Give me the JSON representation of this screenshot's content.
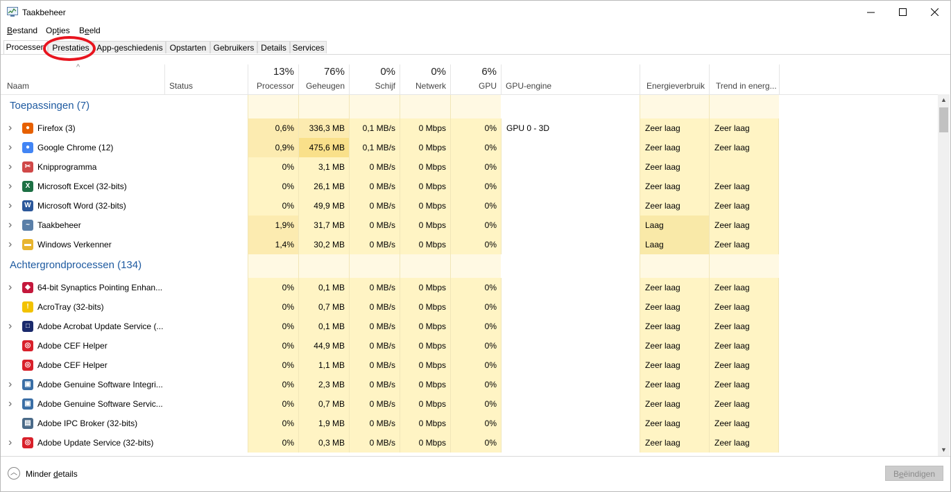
{
  "window": {
    "title": "Taakbeheer"
  },
  "menu": [
    {
      "pre": "",
      "ul": "B",
      "post": "estand"
    },
    {
      "pre": "Op",
      "ul": "t",
      "post": "ies"
    },
    {
      "pre": "B",
      "ul": "e",
      "post": "eld"
    }
  ],
  "tabs": [
    {
      "label": "Processen",
      "active": true
    },
    {
      "label": "Prestaties",
      "active": false
    },
    {
      "label": "App-geschiedenis",
      "active": false
    },
    {
      "label": "Opstarten",
      "active": false
    },
    {
      "label": "Gebruikers",
      "active": false
    },
    {
      "label": "Details",
      "active": false
    },
    {
      "label": "Services",
      "active": false
    }
  ],
  "highlight_color": "#e8141e",
  "columns": {
    "naam": {
      "label": "Naam"
    },
    "status": {
      "label": "Status"
    },
    "processor": {
      "label": "Processor",
      "pct": "13%"
    },
    "geheugen": {
      "label": "Geheugen",
      "pct": "76%"
    },
    "schijf": {
      "label": "Schijf",
      "pct": "0%"
    },
    "netwerk": {
      "label": "Netwerk",
      "pct": "0%"
    },
    "gpu": {
      "label": "GPU",
      "pct": "6%"
    },
    "gpu_engine": {
      "label": "GPU-engine"
    },
    "energie": {
      "label": "Energieverbruik"
    },
    "trend": {
      "label": "Trend in energ..."
    }
  },
  "groups": [
    {
      "title": "Toepassingen (7)",
      "items": [
        {
          "name": "Firefox (3)",
          "icon": "firefox-icon",
          "expandable": true,
          "cpu": "0,6%",
          "mem": "336,3 MB",
          "disk": "0,1 MB/s",
          "net": "0 Mbps",
          "gpu": "0%",
          "engine": "GPU 0 - 3D",
          "energy": "Zeer laag",
          "trend": "Zeer laag",
          "cpu_level": 1,
          "mem_level": 1,
          "energy_level": 0
        },
        {
          "name": "Google Chrome (12)",
          "icon": "chrome-icon",
          "expandable": true,
          "cpu": "0,9%",
          "mem": "475,6 MB",
          "disk": "0,1 MB/s",
          "net": "0 Mbps",
          "gpu": "0%",
          "engine": "",
          "energy": "Zeer laag",
          "trend": "Zeer laag",
          "cpu_level": 1,
          "mem_level": 2,
          "energy_level": 0
        },
        {
          "name": "Knipprogramma",
          "icon": "snipping-tool-icon",
          "expandable": true,
          "cpu": "0%",
          "mem": "3,1 MB",
          "disk": "0 MB/s",
          "net": "0 Mbps",
          "gpu": "0%",
          "engine": "",
          "energy": "Zeer laag",
          "trend": "",
          "cpu_level": 0,
          "mem_level": 0,
          "energy_level": 0
        },
        {
          "name": "Microsoft Excel (32-bits)",
          "icon": "excel-icon",
          "expandable": true,
          "cpu": "0%",
          "mem": "26,1 MB",
          "disk": "0 MB/s",
          "net": "0 Mbps",
          "gpu": "0%",
          "engine": "",
          "energy": "Zeer laag",
          "trend": "Zeer laag",
          "cpu_level": 0,
          "mem_level": 0,
          "energy_level": 0
        },
        {
          "name": "Microsoft Word (32-bits)",
          "icon": "word-icon",
          "expandable": true,
          "cpu": "0%",
          "mem": "49,9 MB",
          "disk": "0 MB/s",
          "net": "0 Mbps",
          "gpu": "0%",
          "engine": "",
          "energy": "Zeer laag",
          "trend": "Zeer laag",
          "cpu_level": 0,
          "mem_level": 0,
          "energy_level": 0
        },
        {
          "name": "Taakbeheer",
          "icon": "task-manager-icon",
          "expandable": true,
          "cpu": "1,9%",
          "mem": "31,7 MB",
          "disk": "0 MB/s",
          "net": "0 Mbps",
          "gpu": "0%",
          "engine": "",
          "energy": "Laag",
          "trend": "Zeer laag",
          "cpu_level": 1,
          "mem_level": 0,
          "energy_level": 1
        },
        {
          "name": "Windows Verkenner",
          "icon": "file-explorer-icon",
          "expandable": true,
          "cpu": "1,4%",
          "mem": "30,2 MB",
          "disk": "0 MB/s",
          "net": "0 Mbps",
          "gpu": "0%",
          "engine": "",
          "energy": "Laag",
          "trend": "Zeer laag",
          "cpu_level": 1,
          "mem_level": 0,
          "energy_level": 1
        }
      ]
    },
    {
      "title": "Achtergrondprocessen (134)",
      "items": [
        {
          "name": "64-bit Synaptics Pointing Enhan...",
          "icon": "synaptics-icon",
          "expandable": true,
          "cpu": "0%",
          "mem": "0,1 MB",
          "disk": "0 MB/s",
          "net": "0 Mbps",
          "gpu": "0%",
          "engine": "",
          "energy": "Zeer laag",
          "trend": "Zeer laag",
          "cpu_level": 0,
          "mem_level": 0,
          "energy_level": 0
        },
        {
          "name": "AcroTray (32-bits)",
          "icon": "acrotray-icon",
          "expandable": false,
          "cpu": "0%",
          "mem": "0,7 MB",
          "disk": "0 MB/s",
          "net": "0 Mbps",
          "gpu": "0%",
          "engine": "",
          "energy": "Zeer laag",
          "trend": "Zeer laag",
          "cpu_level": 0,
          "mem_level": 0,
          "energy_level": 0
        },
        {
          "name": "Adobe Acrobat Update Service (...",
          "icon": "window-icon",
          "expandable": true,
          "cpu": "0%",
          "mem": "0,1 MB",
          "disk": "0 MB/s",
          "net": "0 Mbps",
          "gpu": "0%",
          "engine": "",
          "energy": "Zeer laag",
          "trend": "Zeer laag",
          "cpu_level": 0,
          "mem_level": 0,
          "energy_level": 0
        },
        {
          "name": "Adobe CEF Helper",
          "icon": "adobe-cc-icon",
          "expandable": false,
          "cpu": "0%",
          "mem": "44,9 MB",
          "disk": "0 MB/s",
          "net": "0 Mbps",
          "gpu": "0%",
          "engine": "",
          "energy": "Zeer laag",
          "trend": "Zeer laag",
          "cpu_level": 0,
          "mem_level": 0,
          "energy_level": 0
        },
        {
          "name": "Adobe CEF Helper",
          "icon": "adobe-cc-icon",
          "expandable": false,
          "cpu": "0%",
          "mem": "1,1 MB",
          "disk": "0 MB/s",
          "net": "0 Mbps",
          "gpu": "0%",
          "engine": "",
          "energy": "Zeer laag",
          "trend": "Zeer laag",
          "cpu_level": 0,
          "mem_level": 0,
          "energy_level": 0
        },
        {
          "name": "Adobe Genuine Software Integri...",
          "icon": "service-icon",
          "expandable": true,
          "cpu": "0%",
          "mem": "2,3 MB",
          "disk": "0 MB/s",
          "net": "0 Mbps",
          "gpu": "0%",
          "engine": "",
          "energy": "Zeer laag",
          "trend": "Zeer laag",
          "cpu_level": 0,
          "mem_level": 0,
          "energy_level": 0
        },
        {
          "name": "Adobe Genuine Software Servic...",
          "icon": "service-icon",
          "expandable": true,
          "cpu": "0%",
          "mem": "0,7 MB",
          "disk": "0 MB/s",
          "net": "0 Mbps",
          "gpu": "0%",
          "engine": "",
          "energy": "Zeer laag",
          "trend": "Zeer laag",
          "cpu_level": 0,
          "mem_level": 0,
          "energy_level": 0
        },
        {
          "name": "Adobe IPC Broker (32-bits)",
          "icon": "ipc-broker-icon",
          "expandable": false,
          "cpu": "0%",
          "mem": "1,9 MB",
          "disk": "0 MB/s",
          "net": "0 Mbps",
          "gpu": "0%",
          "engine": "",
          "energy": "Zeer laag",
          "trend": "Zeer laag",
          "cpu_level": 0,
          "mem_level": 0,
          "energy_level": 0
        },
        {
          "name": "Adobe Update Service (32-bits)",
          "icon": "adobe-cc-icon",
          "expandable": true,
          "cpu": "0%",
          "mem": "0,3 MB",
          "disk": "0 MB/s",
          "net": "0 Mbps",
          "gpu": "0%",
          "engine": "",
          "energy": "Zeer laag",
          "trend": "Zeer laag",
          "cpu_level": 0,
          "mem_level": 0,
          "energy_level": 0
        }
      ]
    }
  ],
  "footer": {
    "less_details_pre": "Minder ",
    "less_details_ul": "d",
    "less_details_post": "etails",
    "end_task_pre": "B",
    "end_task_ul": "e",
    "end_task_post": "ëindigen"
  },
  "colors": {
    "heat0": "#fff4c4",
    "heat1": "#fcebb0",
    "heat2": "#f9e08a",
    "group_title": "#1e5aa0"
  }
}
